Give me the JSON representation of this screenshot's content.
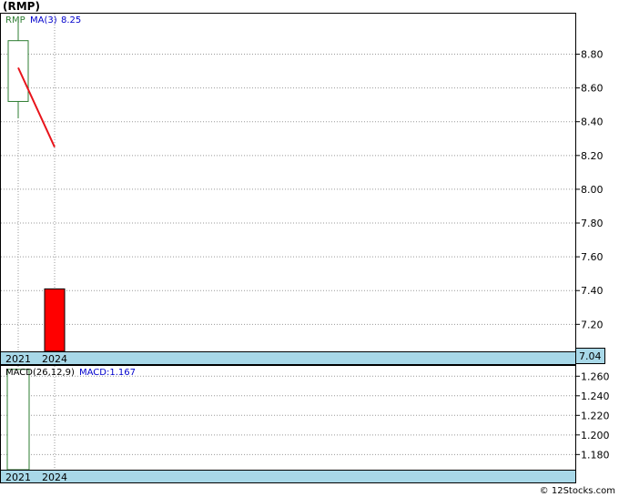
{
  "title": "(RMP)",
  "watermark": "© 12Stocks.com",
  "chart_data": [
    {
      "type": "candlestick",
      "legend": {
        "ticker": "RMP",
        "ma_label": "MA(3)",
        "ma_value": "8.25"
      },
      "x_labels": [
        "2021",
        "2024"
      ],
      "y_ticks": [
        "8.80",
        "8.60",
        "8.40",
        "8.20",
        "8.00",
        "7.80",
        "7.60",
        "7.40",
        "7.20"
      ],
      "ylim": [
        7.04,
        9.04
      ],
      "last_price_label": "7.04",
      "candles": [
        {
          "x": "2021",
          "open": 8.52,
          "close": 8.88,
          "high": 9.0,
          "low": 8.42,
          "direction": "up"
        },
        {
          "x": "2024",
          "open": 7.41,
          "close": 7.04,
          "high": 7.41,
          "low": 7.04,
          "direction": "down"
        }
      ],
      "ma_line": [
        {
          "x": "2021",
          "y": 8.72
        },
        {
          "x": "2024",
          "y": 8.25
        }
      ],
      "colors": {
        "up": "#2e7d32",
        "down": "#ff0000",
        "ma": "#e8141b",
        "axis_band": "#a8d8e8"
      }
    },
    {
      "type": "bar",
      "legend": {
        "label": "MACD(26,12,9)",
        "value_label": "MACD:1.167"
      },
      "x_labels": [
        "2021",
        "2024"
      ],
      "y_ticks": [
        "1.260",
        "1.240",
        "1.220",
        "1.200",
        "1.180"
      ],
      "ylim": [
        1.1645,
        1.2705
      ],
      "bars": [
        {
          "x": "2021",
          "value": 1.267
        }
      ]
    }
  ]
}
